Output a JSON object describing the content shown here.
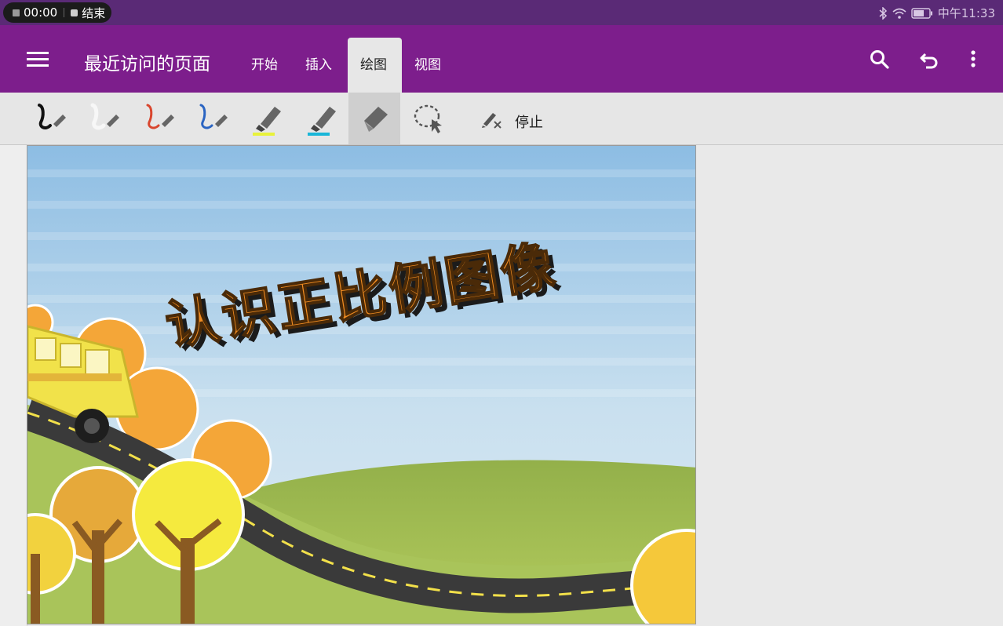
{
  "status_bar": {
    "rec_time": "00:00",
    "end_label": "结束",
    "clock": "中午11:33"
  },
  "app_bar": {
    "page_title": "最近访问的页面",
    "tabs": [
      {
        "label": "开始"
      },
      {
        "label": "插入"
      },
      {
        "label": "绘图"
      },
      {
        "label": "视图"
      }
    ],
    "active_tab": "绘图"
  },
  "ribbon": {
    "tools": [
      {
        "icon": "pen-black-icon",
        "color": "#111111"
      },
      {
        "icon": "pen-white-icon",
        "color": "#f4f4f4"
      },
      {
        "icon": "pen-red-icon",
        "color": "#d9462e"
      },
      {
        "icon": "pen-blue-icon",
        "color": "#2a64c2"
      },
      {
        "icon": "highlighter-yellow-icon",
        "color": "#e8f23a"
      },
      {
        "icon": "highlighter-cyan-icon",
        "color": "#19b6d8"
      },
      {
        "icon": "eraser-icon",
        "color": "#555555"
      },
      {
        "icon": "lasso-select-icon",
        "color": "#555555"
      }
    ],
    "stop_label": "停止"
  },
  "slide": {
    "title_art": "认识正比例图像"
  },
  "colors": {
    "status_bg": "#5a2a76",
    "appbar_bg": "#7d1e8c",
    "ribbon_bg": "#e6e6e6",
    "sky": "#a9cde6",
    "grass": "#9dbf4f"
  }
}
